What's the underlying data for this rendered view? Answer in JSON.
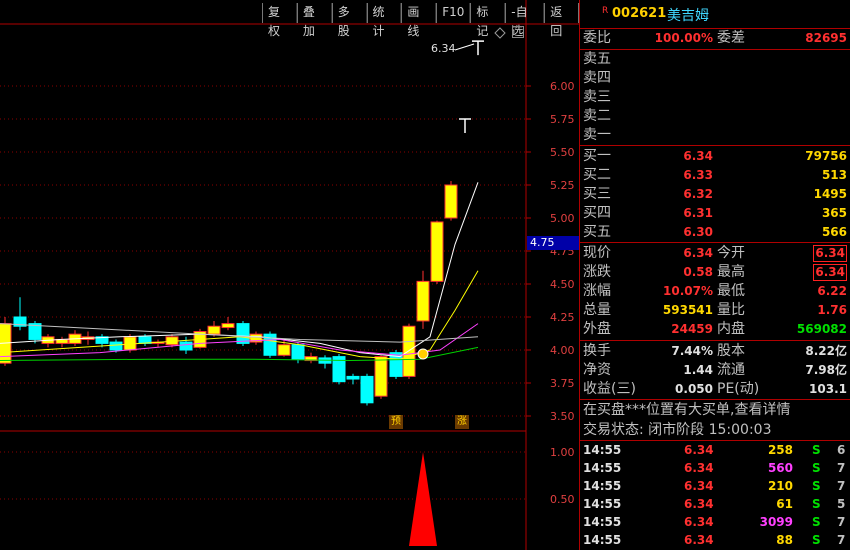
{
  "toolbar": [
    "复权",
    "叠加",
    "多股",
    "统计",
    "画线",
    "F10",
    "标记",
    "-自选",
    "返回"
  ],
  "chart": {
    "price_label": "6.34",
    "y_ticks": [
      "6.00",
      "5.75",
      "5.50",
      "5.25",
      "5.00",
      "4.75",
      "4.50",
      "4.25",
      "4.00",
      "3.75",
      "3.50"
    ],
    "current_price_tag": "4.75",
    "volume_ticks": [
      "1.00",
      "0.50"
    ],
    "badge_yu": "预",
    "badge_zhang": "涨",
    "up_color": "#ffff00",
    "down_color": "#00ffff",
    "highlight_color": "#ff0000"
  },
  "panel": {
    "mark": "R",
    "code": "002621",
    "name": "美吉姆",
    "weibi": {
      "label": "委比",
      "value": "100.00%",
      "label2": "委差",
      "value2": "82695"
    },
    "sell": [
      "卖五",
      "卖四",
      "卖三",
      "卖二",
      "卖一"
    ],
    "buy": [
      {
        "label": "买一",
        "price": "6.34",
        "vol": "79756"
      },
      {
        "label": "买二",
        "price": "6.33",
        "vol": "513"
      },
      {
        "label": "买三",
        "price": "6.32",
        "vol": "1495"
      },
      {
        "label": "买四",
        "price": "6.31",
        "vol": "365"
      },
      {
        "label": "买五",
        "price": "6.30",
        "vol": "566"
      }
    ],
    "quote": [
      {
        "l1": "现价",
        "v1": "6.34",
        "l2": "今开",
        "v2": "6.34"
      },
      {
        "l1": "涨跌",
        "v1": "0.58",
        "l2": "最高",
        "v2": "6.34"
      },
      {
        "l1": "涨幅",
        "v1": "10.07%",
        "l2": "最低",
        "v2": "6.22"
      },
      {
        "l1": "总量",
        "v1": "593541",
        "l2": "量比",
        "v2": "1.76"
      },
      {
        "l1": "外盘",
        "v1": "24459",
        "l2": "内盘",
        "v2": "569082"
      }
    ],
    "fund": [
      {
        "l1": "换手",
        "v1": "7.44%",
        "l2": "股本",
        "v2": "8.22亿"
      },
      {
        "l1": "净资",
        "v1": "1.44",
        "l2": "流通",
        "v2": "7.98亿"
      },
      {
        "l1": "收益(三)",
        "v1": "0.050",
        "l2": "PE(动)",
        "v2": "103.1"
      }
    ],
    "notice": "在买盘***位置有大买单,查看详情",
    "status": "交易状态: 闭市阶段 15:00:03",
    "ticks": [
      {
        "time": "14:55",
        "price": "6.34",
        "vol": "258",
        "side": "S",
        "n": "6"
      },
      {
        "time": "14:55",
        "price": "6.34",
        "vol": "560",
        "side": "S",
        "n": "7"
      },
      {
        "time": "14:55",
        "price": "6.34",
        "vol": "210",
        "side": "S",
        "n": "7"
      },
      {
        "time": "14:55",
        "price": "6.34",
        "vol": "61",
        "side": "S",
        "n": "5"
      },
      {
        "time": "14:55",
        "price": "6.34",
        "vol": "3099",
        "side": "S",
        "n": "7"
      },
      {
        "time": "14:55",
        "price": "6.34",
        "vol": "88",
        "side": "S",
        "n": "7"
      }
    ]
  }
}
